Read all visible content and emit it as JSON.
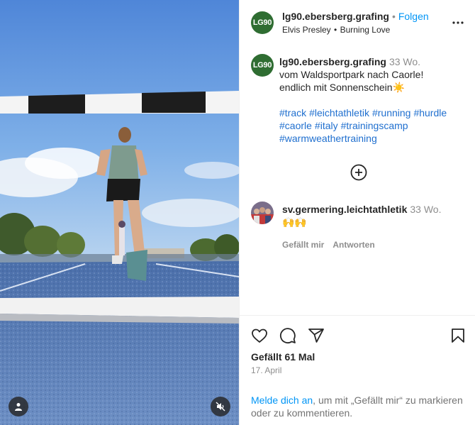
{
  "post": {
    "author": {
      "username": "lg90.ebersberg.grafing",
      "avatar_text": "LG90",
      "follow_label": "Folgen",
      "separator": "•"
    },
    "music": {
      "artist": "Elvis Presley",
      "song": "Burning Love",
      "separator": "•"
    },
    "caption": {
      "username": "lg90.ebersberg.grafing",
      "time_ago": "33 Wo.",
      "line1": "vom Waldsportpark nach Caorle!",
      "line2": "endlich mit Sonnenschein☀️",
      "hashtags": [
        "#track",
        "#leichtathletik",
        "#running",
        "#hurdle",
        "#caorle",
        "#italy",
        "#trainingscamp",
        "#warmweathertraining"
      ]
    },
    "comment": {
      "username": "sv.germering.leichtathletik",
      "time_ago": "33 Wo.",
      "text": "🙌🙌",
      "like_label": "Gefällt mir",
      "reply_label": "Antworten"
    },
    "likes_text": "Gefällt 61 Mal",
    "date": "17. April",
    "login_prompt": {
      "link": "Melde dich an",
      "rest": ", um mit „Gefällt mir“ zu markieren oder zu kommentieren."
    }
  },
  "icons": {
    "more": "more-options-icon",
    "add_comment": "add-circle-icon",
    "like": "heart-icon",
    "comment": "comment-icon",
    "share": "share-icon",
    "save": "bookmark-icon",
    "tag": "user-tag-icon",
    "mute": "muted-speaker-icon"
  },
  "colors": {
    "accent": "#0095f6",
    "hashtag": "#1f6fcf",
    "secondary_text": "#8e8e8e",
    "avatar_bg": "#2f6d32",
    "track": "#5a7fb8"
  }
}
